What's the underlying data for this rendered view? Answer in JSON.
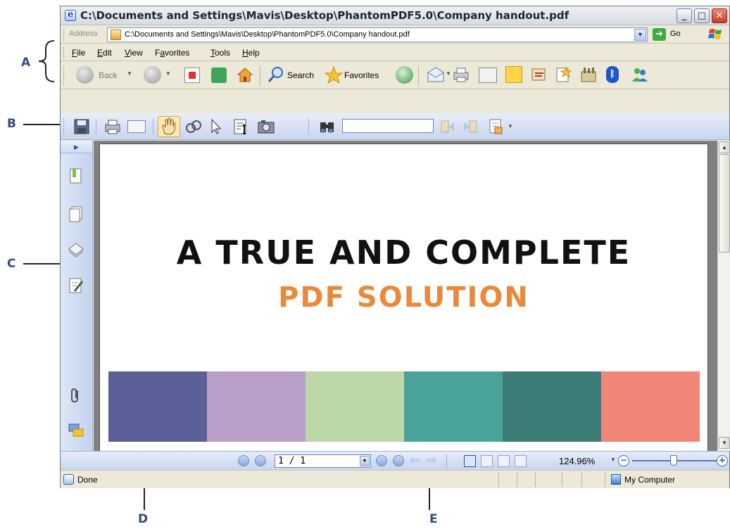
{
  "annotations": {
    "a": "A",
    "b": "B",
    "c": "C",
    "d": "D",
    "e": "E"
  },
  "window": {
    "title": "C:\\Documents and Settings\\Mavis\\Desktop\\PhantomPDF5.0\\Company handout.pdf",
    "minimize": "_",
    "maximize": "□",
    "close": "✕"
  },
  "address_bar": {
    "label": "Address",
    "value": "C:\\Documents and Settings\\Mavis\\Desktop\\PhantomPDF5.0\\Company handout.pdf",
    "go_label": "Go",
    "go_glyph": "➔"
  },
  "menu": [
    "File",
    "Edit",
    "View",
    "Favorites",
    "Tools",
    "Help"
  ],
  "menu_underlines": [
    "F",
    "E",
    "V",
    "a",
    "T",
    "H"
  ],
  "ie_toolbar": {
    "back": "Back",
    "search": "Search",
    "favorites": "Favorites"
  },
  "document": {
    "headline": "A TRUE AND COMPLETE",
    "subheadline": "PDF SOLUTION",
    "color_strip": [
      "#5b6198",
      "#b9a0c8",
      "#bcd7a8",
      "#4aa39b",
      "#3d7d78",
      "#f18678"
    ]
  },
  "nav_bar": {
    "page_value": "1 / 1",
    "zoom": "124.96%"
  },
  "status_bar": {
    "status": "Done",
    "zone": "My Computer"
  },
  "colors": {
    "accent_blue": "#3a4a7a",
    "toolbar_blue": "#c9d6ee",
    "headline_orange": "#e98a3a"
  }
}
